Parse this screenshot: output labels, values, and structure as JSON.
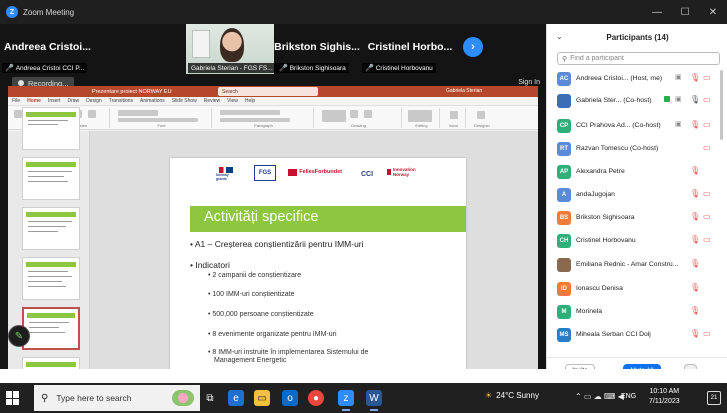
{
  "zoom": {
    "title": "Zoom Meeting",
    "recording_label": "Recording...",
    "signin_label": "Sign In"
  },
  "videos": [
    {
      "big": "Andreea Cristoi...",
      "small": "Andreea Cristoi CCI P..."
    },
    {
      "big": "",
      "small": "Gabriela Sterian - FGS FS..."
    },
    {
      "big": "Brikston Sighis...",
      "small": "Brikston Sighisoara"
    },
    {
      "big": "Cristinel Horbo...",
      "small": "Cristinel Horbovanu"
    }
  ],
  "ppt": {
    "title": "Prezentare proiect NORWAY EU",
    "search": "Search",
    "user": "Gabriela Sterian",
    "menu": [
      "File",
      "Home",
      "Insert",
      "Draw",
      "Design",
      "Transitions",
      "Animations",
      "Slide Show",
      "Review",
      "View",
      "Help"
    ],
    "ribbon_groups": [
      "Clipboard",
      "Slides",
      "Font",
      "Paragraph",
      "Drawing",
      "Editing",
      "Voice",
      "Designer"
    ]
  },
  "slide": {
    "logos": {
      "norway": "Norway grants",
      "fgs": "FGS",
      "fpc": "FellesForbundet",
      "ccib": "CCI",
      "inno": "Innovation Norway"
    },
    "title": "Activități specifice",
    "line1": "• A1 – Creșterea conștientizării pentru IMM-uri",
    "line2": "• Indicatori",
    "subs": [
      "• 2 campanii de conștientizare",
      "• 100 IMM-uri conștientizate",
      "• 500,000 persoane conștientizate",
      "• 8 evenimente organizate pentru IMM-uri",
      "• 8 IMM-uri instruite în implementarea Sistemului de",
      "Management Energetic"
    ]
  },
  "panel": {
    "title": "Participants (14)",
    "search_placeholder": "Find a participant",
    "participants": [
      {
        "initials": "AC",
        "name": "Andreea Cristoi... (Host, me)",
        "color": "#5b8bd6"
      },
      {
        "initials": "",
        "name": "Gabriela Ster... (Co-host)",
        "color": "#3d6db5"
      },
      {
        "initials": "CP",
        "name": "CCI Prahova Ad... (Co-host)",
        "color": "#2fb07a"
      },
      {
        "initials": "RT",
        "name": "Razvan Tomescu (Co-host)",
        "color": "#5b8bd6"
      },
      {
        "initials": "AP",
        "name": "Alexandra Petre",
        "color": "#2fb07a"
      },
      {
        "initials": "A",
        "name": "andaJugojan",
        "color": "#5b8bd6"
      },
      {
        "initials": "BS",
        "name": "Brikston Sighisoara",
        "color": "#f07a3a"
      },
      {
        "initials": "CH",
        "name": "Cristinel Horbovanu",
        "color": "#2fb07a"
      },
      {
        "initials": "",
        "name": "Emiliana Rednic - Amar Constru...",
        "color": "#8a6a4e"
      },
      {
        "initials": "ID",
        "name": "Ionascu Denisa",
        "color": "#f07a3a"
      },
      {
        "initials": "M",
        "name": "Morinela",
        "color": "#2fb07a"
      },
      {
        "initials": "MS",
        "name": "Miheala Serban CCI Dolj",
        "color": "#2a7cc7"
      }
    ],
    "invite_label": "Invite",
    "mute_all_label": "Mute All",
    "more_label": "..."
  },
  "taskbar": {
    "search_placeholder": "Type here to search",
    "weather": "24°C  Sunny",
    "lang": "ENG",
    "time": "10:10 AM",
    "date": "7/11/2023",
    "notif_count": "21"
  }
}
